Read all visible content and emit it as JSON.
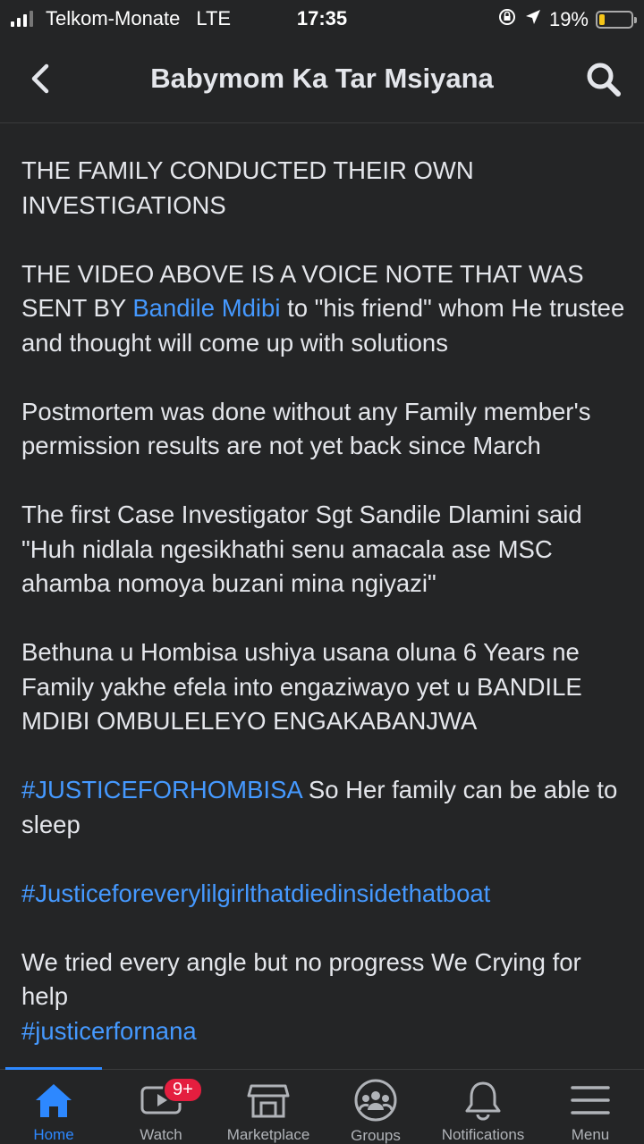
{
  "status_bar": {
    "carrier": "Telkom-Monate",
    "network": "LTE",
    "time": "17:35",
    "battery": "19%",
    "battery_level": 0.19
  },
  "header": {
    "title": "Babymom Ka Tar Msiyana",
    "back_icon": "chevron-left-icon",
    "search_icon": "search-icon"
  },
  "post": {
    "p1": "THE FAMILY CONDUCTED THEIR OWN INVESTIGATIONS",
    "p2_before": "THE VIDEO ABOVE IS A VOICE NOTE THAT WAS SENT BY ",
    "p2_link": "Bandile Mdibi",
    "p2_after": "  to \"his friend\" whom He trustee and thought will come up with solutions",
    "p3": "Postmortem was done without any Family member's permission results are not yet back since March",
    "p4": "The first Case Investigator Sgt Sandile Dlamini said \"Huh nidlala ngesikhathi senu amacala ase MSC ahamba nomoya buzani mina ngiyazi\"",
    "p5": "Bethuna u Hombisa ushiya usana oluna 6 Years  ne Family yakhe efela into engaziwayo yet u BANDILE MDIBI OMBULELEYO ENGAKABANJWA",
    "p6_hashtag": "#JUSTICEFORHOMBISA",
    "p6_after": " So Her family can be able to sleep",
    "p7_hashtag": "#Justiceforeverylilgirlthatdiedinsidethatboat",
    "p8": "We tried every angle but no progress We Crying for help",
    "p9_hashtag": "#justicerfornana"
  },
  "bottom_nav": {
    "items": [
      {
        "label": "Home",
        "icon": "home-icon",
        "active": true
      },
      {
        "label": "Watch",
        "icon": "watch-icon",
        "badge": "9+"
      },
      {
        "label": "Marketplace",
        "icon": "marketplace-icon"
      },
      {
        "label": "Groups",
        "icon": "groups-icon"
      },
      {
        "label": "Notifications",
        "icon": "bell-icon"
      },
      {
        "label": "Menu",
        "icon": "menu-icon"
      }
    ]
  },
  "colors": {
    "background": "#242526",
    "text": "#e4e6eb",
    "link": "#4599ff",
    "active": "#2d88ff",
    "badge": "#e41e3f"
  }
}
